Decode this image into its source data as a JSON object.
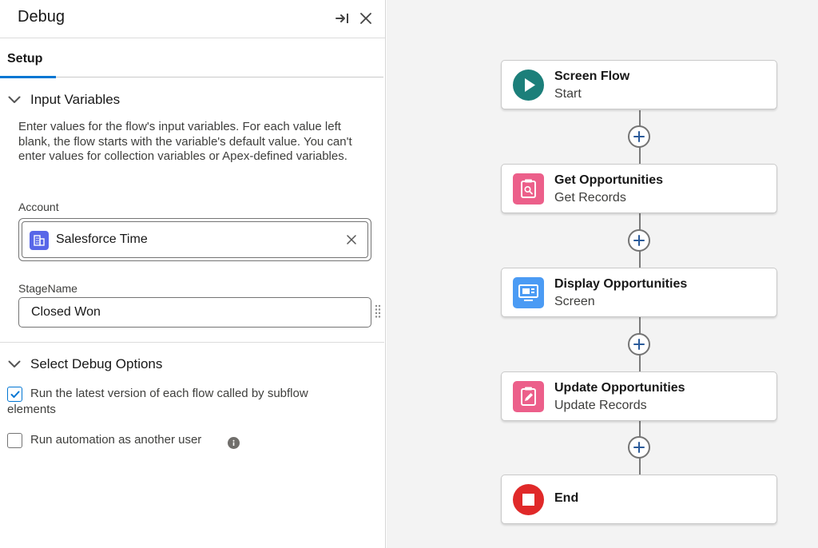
{
  "panel": {
    "title": "Debug",
    "tabs": [
      {
        "label": "Setup",
        "active": true
      }
    ]
  },
  "input_variables": {
    "section_title": "Input Variables",
    "help_text": "Enter values for the flow's input variables. For each value left blank, the flow starts with the variable's default value. You can't enter values for collection variables or Apex-defined variables.",
    "account": {
      "label": "Account",
      "value": "Salesforce Time",
      "icon": "account-icon"
    },
    "stage_name": {
      "label": "StageName",
      "value": "Closed Won"
    }
  },
  "debug_options": {
    "section_title": "Select Debug Options",
    "options": [
      {
        "label_line1": "Run the latest version of each flow called by subflow",
        "label_line2": "elements",
        "checked": true
      },
      {
        "label": "Run automation as another user",
        "checked": false,
        "has_info": true
      }
    ]
  },
  "flow": {
    "nodes": [
      {
        "title": "Screen Flow",
        "subtitle": "Start",
        "icon": "play-icon",
        "color": "#1c7f7a"
      },
      {
        "title": "Get Opportunities",
        "subtitle": "Get Records",
        "icon": "get-records-icon",
        "color": "#ec5f8a"
      },
      {
        "title": "Display Opportunities",
        "subtitle": "Screen",
        "icon": "screen-icon",
        "color": "#4b9bf4"
      },
      {
        "title": "Update Opportunities",
        "subtitle": "Update Records",
        "icon": "update-records-icon",
        "color": "#ec5f8a"
      },
      {
        "title": "End",
        "subtitle": "",
        "icon": "stop-icon",
        "color": "#e02929"
      }
    ]
  },
  "colors": {
    "brand_blue": "#0176d3",
    "canvas_bg": "#f3f3f3"
  }
}
